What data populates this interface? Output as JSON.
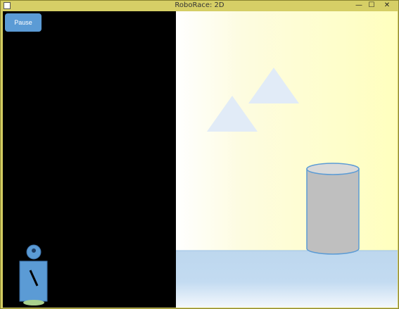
{
  "window": {
    "title": "RoboRace: 2D",
    "minimize_glyph": "—",
    "maximize_glyph": "☐",
    "close_glyph": "✕"
  },
  "game": {
    "pause_label": "Pause"
  },
  "colors": {
    "button": "#5b9bd5",
    "robot": "#5b9bd5",
    "triangle": "#e1ebf7",
    "cylinder": "#bfbfbf",
    "cylinder_outline": "#5b9bd5",
    "ground": "#bdd7ee",
    "left_panel": "#000000"
  },
  "icons": {
    "app": "app-icon",
    "robot": "robot-sprite"
  }
}
